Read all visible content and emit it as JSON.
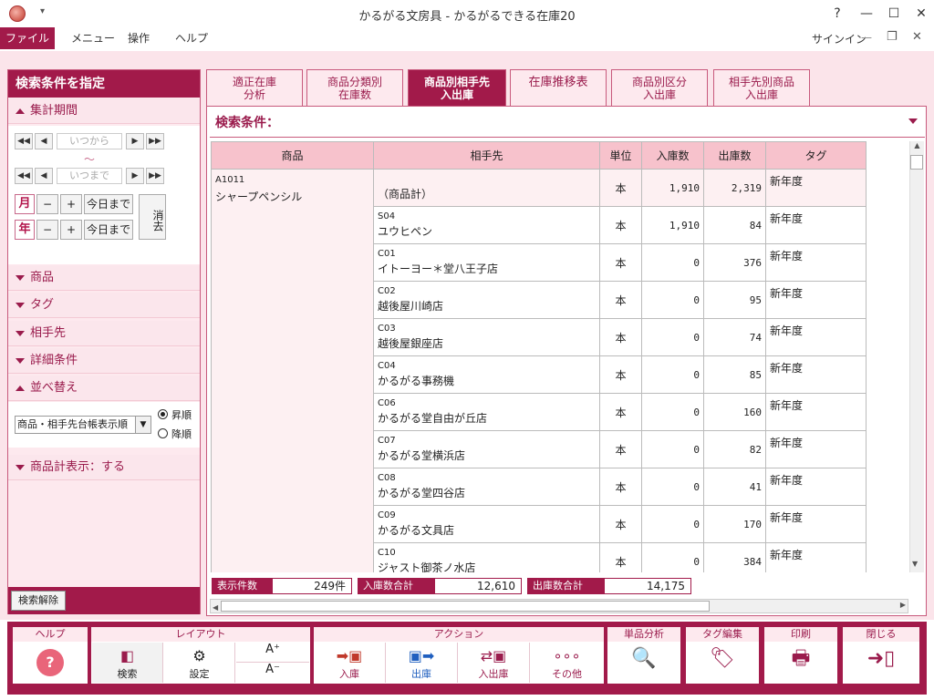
{
  "window": {
    "title": "かるがる文房具 - かるがるできる在庫20",
    "qa_arrow": "▾",
    "buttons": {
      "help": "?",
      "minimize": "—",
      "maximize": "☐",
      "close": "✕"
    }
  },
  "menubar": {
    "items": [
      "ファイル",
      "メニュー",
      "操作",
      "ヘルプ"
    ],
    "signin": "サインイン",
    "ribbon_min": "—",
    "restore": "❐"
  },
  "left_panel": {
    "header": "検索条件を指定",
    "period": {
      "label": "集計期間",
      "from_placeholder": "いつから",
      "separator": "～",
      "to_placeholder": "いつまで",
      "month_label": "月",
      "year_label": "年",
      "minus": "−",
      "plus": "+",
      "today": "今日まで",
      "clear": "消去"
    },
    "sections": [
      "商品",
      "タグ",
      "相手先",
      "詳細条件",
      "並べ替え"
    ],
    "sort": {
      "selected": "商品・相手先台帳表示順",
      "asc": "昇順",
      "desc": "降順",
      "asc_selected": true
    },
    "product_total": "商品計表示：する",
    "clear_button": "検索解除"
  },
  "tabs": [
    {
      "label1": "適正在庫",
      "label2": "分析"
    },
    {
      "label1": "商品分類別",
      "label2": "在庫数"
    },
    {
      "label1": "商品別相手先",
      "label2": "入出庫"
    },
    {
      "label1": "在庫推移表",
      "label2": ""
    },
    {
      "label1": "商品別区分",
      "label2": "入出庫"
    },
    {
      "label1": "相手先別商品",
      "label2": "入出庫"
    }
  ],
  "active_tab": 2,
  "search_condition": "検索条件：",
  "table": {
    "headers": [
      "商品",
      "相手先",
      "単位",
      "入庫数",
      "出庫数",
      "タグ"
    ],
    "product_code": "A1011",
    "product_name": "シャープペンシル",
    "rows": [
      {
        "code": "",
        "name": "（商品計）",
        "unit": "本",
        "in": "1,910",
        "out": "2,319",
        "tag": "新年度"
      },
      {
        "code": "S04",
        "name": "ユウヒペン",
        "unit": "本",
        "in": "1,910",
        "out": "84",
        "tag": "新年度"
      },
      {
        "code": "C01",
        "name": "イトーヨー＊堂八王子店",
        "unit": "本",
        "in": "0",
        "out": "376",
        "tag": "新年度"
      },
      {
        "code": "C02",
        "name": "越後屋川崎店",
        "unit": "本",
        "in": "0",
        "out": "95",
        "tag": "新年度"
      },
      {
        "code": "C03",
        "name": "越後屋銀座店",
        "unit": "本",
        "in": "0",
        "out": "74",
        "tag": "新年度"
      },
      {
        "code": "C04",
        "name": "かるがる事務機",
        "unit": "本",
        "in": "0",
        "out": "85",
        "tag": "新年度"
      },
      {
        "code": "C06",
        "name": "かるがる堂自由が丘店",
        "unit": "本",
        "in": "0",
        "out": "160",
        "tag": "新年度"
      },
      {
        "code": "C07",
        "name": "かるがる堂横浜店",
        "unit": "本",
        "in": "0",
        "out": "82",
        "tag": "新年度"
      },
      {
        "code": "C08",
        "name": "かるがる堂四谷店",
        "unit": "本",
        "in": "0",
        "out": "41",
        "tag": "新年度"
      },
      {
        "code": "C09",
        "name": "かるがる文具店",
        "unit": "本",
        "in": "0",
        "out": "170",
        "tag": "新年度"
      },
      {
        "code": "C10",
        "name": "ジャスト御茶ノ水店",
        "unit": "本",
        "in": "0",
        "out": "384",
        "tag": "新年度"
      }
    ]
  },
  "summary": {
    "count_label": "表示件数",
    "count_value": "249件",
    "in_label": "入庫数合計",
    "in_value": "12,610",
    "out_label": "出庫数合計",
    "out_value": "14,175"
  },
  "ribbon": {
    "groups": {
      "help": "ヘルプ",
      "layout": "レイアウト",
      "action": "アクション",
      "analysis": "単品分析",
      "tag_edit": "タグ編集",
      "print": "印刷",
      "close": "閉じる"
    },
    "buttons": {
      "search": "検索",
      "settings": "設定",
      "font_up": "A⁺",
      "font_down": "A⁻",
      "in": "入庫",
      "out": "出庫",
      "in_out": "入出庫",
      "other": "その他"
    },
    "accent": "#a21a4a"
  }
}
